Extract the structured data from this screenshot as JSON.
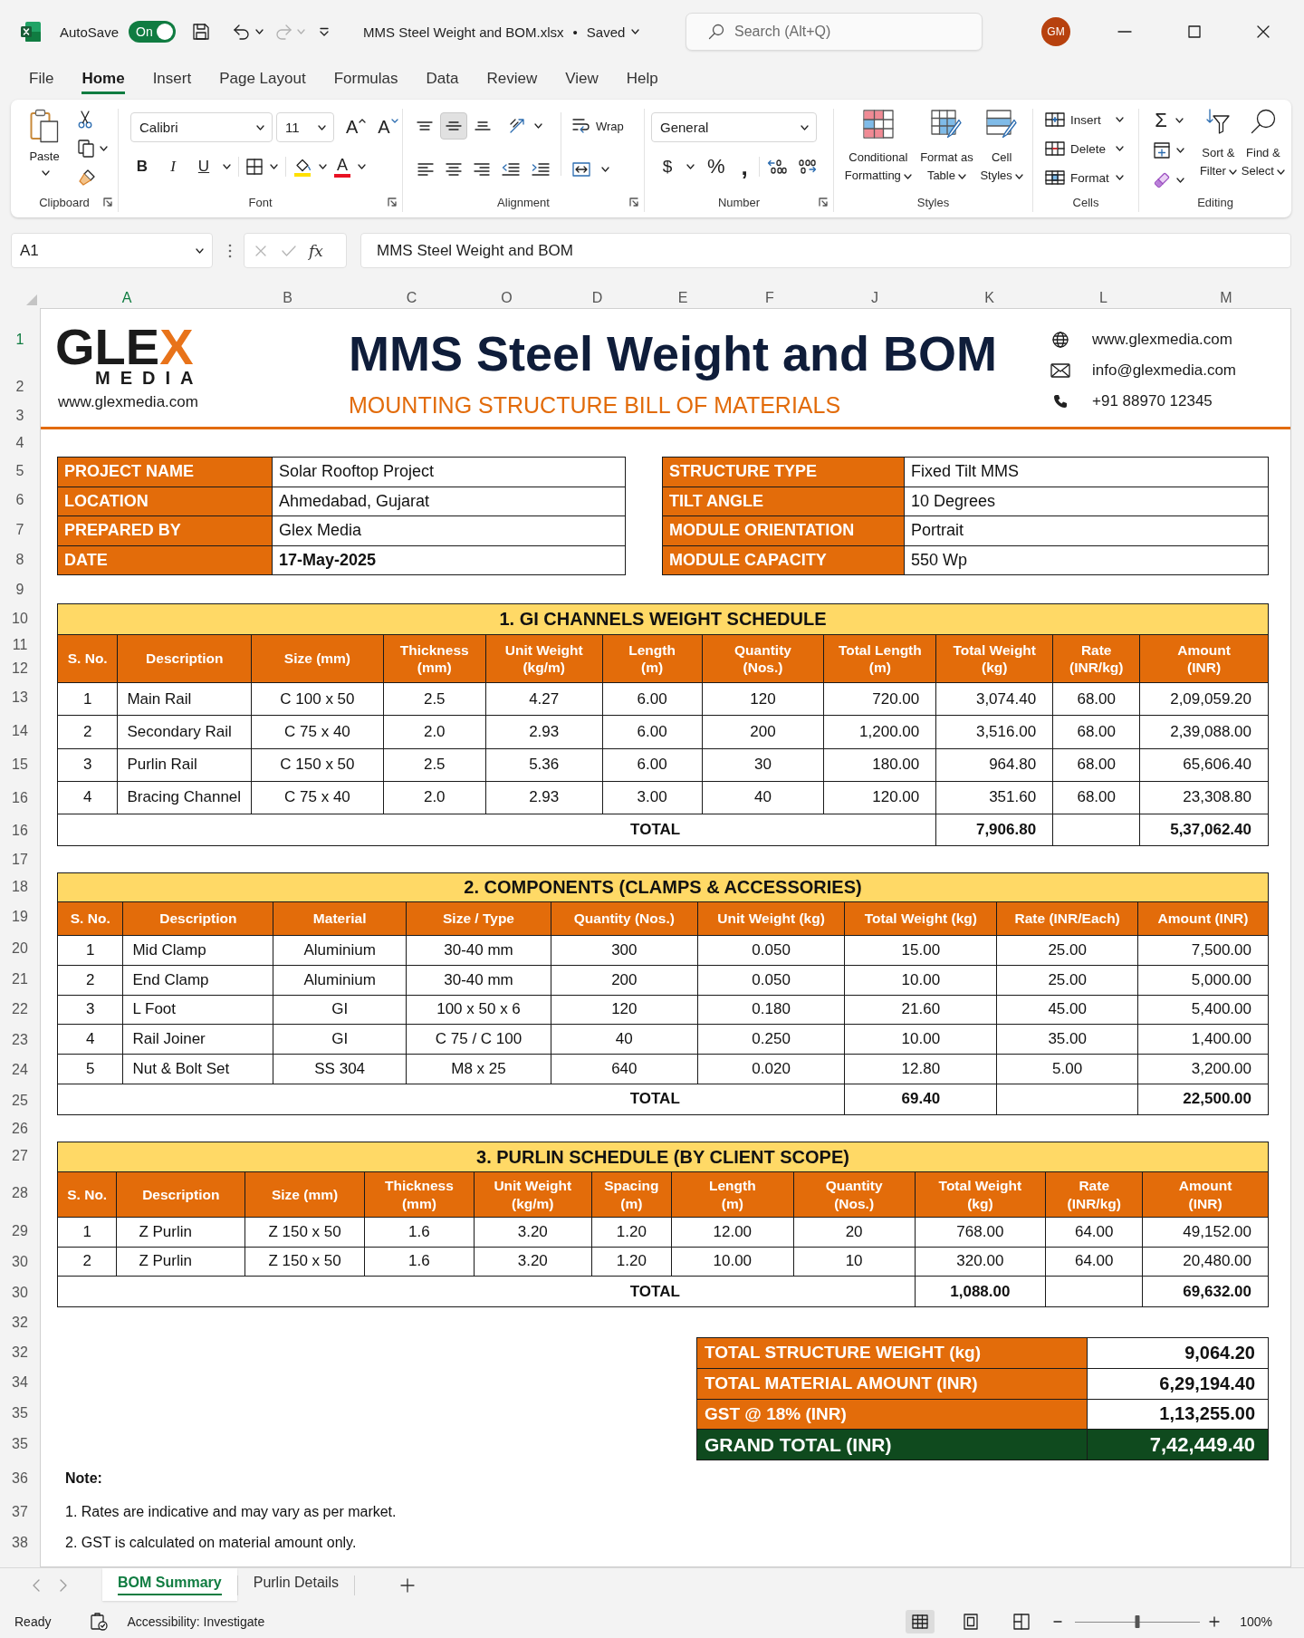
{
  "title_bar": {
    "autosave": {
      "label": "AutoSave",
      "toggle": "On",
      "on": true
    },
    "file_name": "MMS Steel Weight and BOM.xlsx",
    "separator": "•",
    "save_status": "Saved",
    "search": {
      "placeholder": "Search (Alt+Q)"
    },
    "avatar": "GM"
  },
  "menu_tabs": [
    {
      "label": "File",
      "selected": false
    },
    {
      "label": "Home",
      "selected": true
    },
    {
      "label": "Insert",
      "selected": false
    },
    {
      "label": "Page Layout",
      "selected": false
    },
    {
      "label": "Formulas",
      "selected": false
    },
    {
      "label": "Data",
      "selected": false
    },
    {
      "label": "Review",
      "selected": false
    },
    {
      "label": "View",
      "selected": false
    },
    {
      "label": "Help",
      "selected": false
    }
  ],
  "ribbon": {
    "clipboard": {
      "paste": "Paste",
      "label": "Clipboard"
    },
    "font": {
      "font_name": "Calibri",
      "font_size": "11",
      "grow": "A",
      "shrink": "A",
      "bold": "B",
      "italic": "I",
      "underline": "U",
      "font_color": "A",
      "label": "Font"
    },
    "alignment": {
      "vertical_buttons": [
        {
          "selected": false
        },
        {
          "selected": true
        },
        {
          "selected": false
        }
      ],
      "wrap": "Wrap",
      "label": "Alignment"
    },
    "number": {
      "format": "General",
      "currency": "$",
      "percent": "%",
      "comma": ",",
      "label": "Number"
    },
    "styles": {
      "buttons": [
        "Conditional\nFormatting",
        "Format as\nTable",
        "Cell\nStyles"
      ],
      "label": "Styles"
    },
    "cells": {
      "buttons": [
        "Insert",
        "Delete",
        "Format"
      ],
      "label": "Cells"
    },
    "editing": {
      "sum": "Σ",
      "buttons": [
        "Sort &\nFilter",
        "Find &\nSelect"
      ],
      "label": "Editing"
    }
  },
  "formula_bar": {
    "name_box": "A1",
    "function_button": "fx",
    "formula": "MMS Steel Weight and BOM"
  },
  "sheet": {
    "columns": [
      {
        "label": "A",
        "selected": true
      },
      {
        "label": "B",
        "selected": false
      },
      {
        "label": "C",
        "selected": false
      },
      {
        "label": "O",
        "selected": false
      },
      {
        "label": "D",
        "selected": false
      },
      {
        "label": "E",
        "selected": false
      },
      {
        "label": "F",
        "selected": false
      },
      {
        "label": "J",
        "selected": false
      },
      {
        "label": "K",
        "selected": false
      },
      {
        "label": "L",
        "selected": false
      },
      {
        "label": "M",
        "selected": false
      }
    ],
    "rows": [
      {
        "label": "1",
        "selected": true
      },
      {
        "label": "2",
        "selected": false
      },
      {
        "label": "3",
        "selected": false
      },
      {
        "label": "4",
        "selected": false
      },
      {
        "label": "5",
        "selected": false
      },
      {
        "label": "6",
        "selected": false
      },
      {
        "label": "7",
        "selected": false
      },
      {
        "label": "8",
        "selected": false
      },
      {
        "label": "9",
        "selected": false
      },
      {
        "label": "10",
        "selected": false
      },
      {
        "label": "11",
        "selected": false
      },
      {
        "label": "12",
        "selected": false
      },
      {
        "label": "13",
        "selected": false
      },
      {
        "label": "14",
        "selected": false
      },
      {
        "label": "15",
        "selected": false
      },
      {
        "label": "16",
        "selected": false
      },
      {
        "label": "16",
        "selected": false
      },
      {
        "label": "17",
        "selected": false
      },
      {
        "label": "18",
        "selected": false
      },
      {
        "label": "19",
        "selected": false
      },
      {
        "label": "20",
        "selected": false
      },
      {
        "label": "21",
        "selected": false
      },
      {
        "label": "22",
        "selected": false
      },
      {
        "label": "23",
        "selected": false
      },
      {
        "label": "24",
        "selected": false
      },
      {
        "label": "25",
        "selected": false
      },
      {
        "label": "26",
        "selected": false
      },
      {
        "label": "27",
        "selected": false
      },
      {
        "label": "28",
        "selected": false
      },
      {
        "label": "29",
        "selected": false
      },
      {
        "label": "30",
        "selected": false
      },
      {
        "label": "30",
        "selected": false
      },
      {
        "label": "32",
        "selected": false
      },
      {
        "label": "32",
        "selected": false
      },
      {
        "label": "34",
        "selected": false
      },
      {
        "label": "35",
        "selected": false
      },
      {
        "label": "35",
        "selected": false
      },
      {
        "label": "36",
        "selected": false
      },
      {
        "label": "37",
        "selected": false
      },
      {
        "label": "38",
        "selected": false
      }
    ],
    "header": {
      "logo": {
        "wordmark": "GLEX",
        "tagline": "MEDIA",
        "website": "www.glexmedia.com"
      },
      "title": "MMS Steel Weight and BOM",
      "subtitle": "MOUNTING STRUCTURE BILL OF MATERIALS",
      "contacts": [
        {
          "kind": "web",
          "text": "www.glexmedia.com"
        },
        {
          "kind": "email",
          "text": "info@glexmedia.com"
        },
        {
          "kind": "phone",
          "text": "+91 88970 12345"
        }
      ]
    },
    "project_info": [
      [
        {
          "label": "PROJECT NAME",
          "value": "Solar Rooftop Project",
          "bold": false
        },
        {
          "label": "LOCATION",
          "value": "Ahmedabad, Gujarat",
          "bold": false
        },
        {
          "label": "PREPARED BY",
          "value": "Glex Media",
          "bold": false
        },
        {
          "label": "DATE",
          "value": "17-May-2025",
          "bold": true
        }
      ],
      [
        {
          "label": "STRUCTURE TYPE",
          "value": "Fixed Tilt MMS",
          "bold": false
        },
        {
          "label": "TILT ANGLE",
          "value": "10 Degrees",
          "bold": false
        },
        {
          "label": "MODULE ORIENTATION",
          "value": "Portrait",
          "bold": false
        },
        {
          "label": "MODULE CAPACITY",
          "value": "550 Wp",
          "bold": false
        }
      ]
    ],
    "tables": [
      {
        "title": "1. GI CHANNELS WEIGHT SCHEDULE",
        "columns": [
          "S. No.",
          "Description",
          "Size (mm)",
          "Thickness\n(mm)",
          "Unit Weight\n(kg/m)",
          "Length\n(m)",
          "Quantity\n(Nos.)",
          "Total Length\n(m)",
          "Total Weight\n(kg)",
          "Rate\n(INR/kg)",
          "Amount\n(INR)"
        ],
        "rows": [
          [
            "1",
            "Main Rail",
            "C 100 x 50",
            "2.5",
            "4.27",
            "6.00",
            "120",
            "720.00",
            "3,074.40",
            "68.00",
            "2,09,059.20"
          ],
          [
            "2",
            "Secondary Rail",
            "C 75 x 40",
            "2.0",
            "2.93",
            "6.00",
            "200",
            "1,200.00",
            "3,516.00",
            "68.00",
            "2,39,088.00"
          ],
          [
            "3",
            "Purlin Rail",
            "C 150 x 50",
            "2.5",
            "5.36",
            "6.00",
            "30",
            "180.00",
            "964.80",
            "68.00",
            "65,606.40"
          ],
          [
            "4",
            "Bracing Channel",
            "C 75 x 40",
            "2.0",
            "2.93",
            "3.00",
            "40",
            "120.00",
            "351.60",
            "68.00",
            "23,308.80"
          ]
        ],
        "total": {
          "label": "TOTAL",
          "total_weight": "7,906.80",
          "amount": "5,37,062.40"
        }
      },
      {
        "title": "2. COMPONENTS (CLAMPS & ACCESSORIES)",
        "columns": [
          "S. No.",
          "Description",
          "Material",
          "Size / Type",
          "Quantity (Nos.)",
          "Unit Weight (kg)",
          "Total Weight (kg)",
          "Rate (INR/Each)",
          "Amount (INR)"
        ],
        "rows": [
          [
            "1",
            "Mid Clamp",
            "Aluminium",
            "30-40 mm",
            "300",
            "0.050",
            "15.00",
            "25.00",
            "7,500.00"
          ],
          [
            "2",
            "End Clamp",
            "Aluminium",
            "30-40 mm",
            "200",
            "0.050",
            "10.00",
            "25.00",
            "5,000.00"
          ],
          [
            "3",
            "L Foot",
            "GI",
            "100 x 50 x 6",
            "120",
            "0.180",
            "21.60",
            "45.00",
            "5,400.00"
          ],
          [
            "4",
            "Rail Joiner",
            "GI",
            "C 75 / C 100",
            "40",
            "0.250",
            "10.00",
            "35.00",
            "1,400.00"
          ],
          [
            "5",
            "Nut & Bolt Set",
            "SS 304",
            "M8 x 25",
            "640",
            "0.020",
            "12.80",
            "5.00",
            "3,200.00"
          ]
        ],
        "total": {
          "label": "TOTAL",
          "total_weight": "69.40",
          "amount": "22,500.00"
        }
      },
      {
        "title": "3. PURLIN SCHEDULE (BY CLIENT SCOPE)",
        "columns": [
          "S. No.",
          "Description",
          "Size (mm)",
          "Thickness\n(mm)",
          "Unit Weight\n(kg/m)",
          "Spacing\n(m)",
          "Length\n(m)",
          "Quantity\n(Nos.)",
          "Total Weight\n(kg)",
          "Rate\n(INR/kg)",
          "Amount\n(INR)"
        ],
        "rows": [
          [
            "1",
            "Z Purlin",
            "Z 150 x 50",
            "1.6",
            "3.20",
            "1.20",
            "12.00",
            "20",
            "768.00",
            "64.00",
            "49,152.00"
          ],
          [
            "2",
            "Z Purlin",
            "Z 150 x 50",
            "1.6",
            "3.20",
            "1.20",
            "10.00",
            "10",
            "320.00",
            "64.00",
            "20,480.00"
          ]
        ],
        "total": {
          "label": "TOTAL",
          "total_weight": "1,088.00",
          "amount": "69,632.00"
        }
      }
    ],
    "summary": [
      {
        "kind": "subtotal",
        "label": "TOTAL STRUCTURE WEIGHT (kg)",
        "value": "9,064.20"
      },
      {
        "kind": "subtotal",
        "label": "TOTAL MATERIAL AMOUNT (INR)",
        "value": "6,29,194.40"
      },
      {
        "kind": "subtotal",
        "label": "GST @ 18% (INR)",
        "value": "1,13,255.00"
      },
      {
        "kind": "grand",
        "label": "GRAND TOTAL (INR)",
        "value": "7,42,449.40"
      }
    ],
    "note": {
      "title": "Note:",
      "items": [
        "1. Rates are indicative and may vary as per market.",
        "2. GST is calculated on material amount only."
      ]
    }
  },
  "sheet_tabs": [
    {
      "label": "BOM Summary",
      "selected": true
    },
    {
      "label": "Purlin Details",
      "selected": false
    }
  ],
  "status_bar": {
    "status": "Ready",
    "accessibility": "Accessibility: Investigate",
    "view_buttons": [
      {
        "selected": true
      },
      {
        "selected": false
      },
      {
        "selected": false
      }
    ],
    "zoom": {
      "level": 0.5
    },
    "zoom_percent": "100%"
  }
}
